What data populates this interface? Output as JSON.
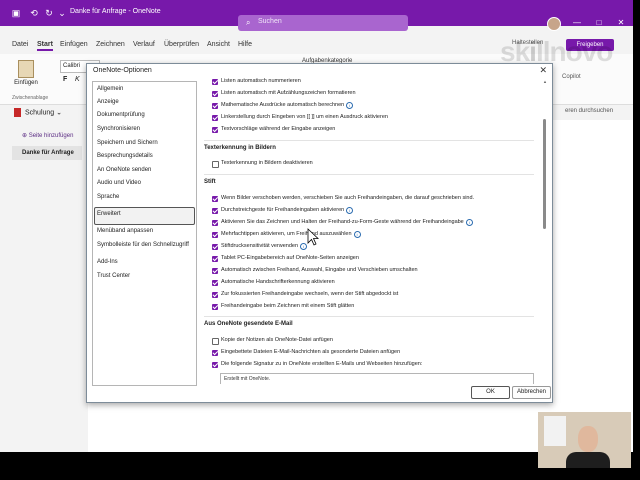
{
  "titlebar": {
    "doc_title": "Danke für Anfrage  -  OneNote",
    "search_placeholder": "Suchen",
    "bg_color": "#7719aa"
  },
  "menubar": {
    "tabs": [
      "Datei",
      "Start",
      "Einfügen",
      "Zeichnen",
      "Verlauf",
      "Überprüfen",
      "Ansicht",
      "Hilfe"
    ],
    "active_tab": "Start",
    "share_label": "Freigeben",
    "haltestellen": "Haltestellen"
  },
  "ribbon": {
    "paste_label": "Einfügen",
    "font_value": "Calibri",
    "bold": "F",
    "italic": "K",
    "clipboard_label": "Zwischenablage",
    "tag_label": "Aufgabenkategorie",
    "copilot_label": "Copilot",
    "search_right": "eren durchsuchen"
  },
  "nav": {
    "notebook": "Schulung",
    "add_page": "Seite hinzufügen",
    "page": "Danke für Anfrage"
  },
  "logo": "skillnovo",
  "dialog": {
    "title": "OneNote-Optionen",
    "nav_items": [
      "Allgemein",
      "Anzeige",
      "Dokumentprüfung",
      "Synchronisieren",
      "Speichern und Sichern",
      "Besprechungsdetails",
      "An OneNote senden",
      "Audio und Video",
      "Sprache",
      "Erweitert",
      "Menüband anpassen",
      "Symbolleiste für den Schnellzugriff",
      "Add-Ins",
      "Trust Center"
    ],
    "active_nav": "Erweitert",
    "top_options": [
      {
        "label": "Listen automatisch nummerieren",
        "checked": true
      },
      {
        "label": "Listen automatisch mit Aufzählungszeichen formatieren",
        "checked": true
      },
      {
        "label": "Mathematische Ausdrücke automatisch berechnen",
        "checked": true,
        "info": true
      },
      {
        "label": "Linkerstellung durch Eingeben von [[ ]] um einen Ausdruck aktivieren",
        "checked": true
      },
      {
        "label": "Textvorschläge während der Eingabe anzeigen",
        "checked": true
      }
    ],
    "section_ocr": {
      "heading": "Texterkennung in Bildern",
      "options": [
        {
          "label": "Texterkennung in Bildern deaktivieren",
          "checked": false
        }
      ]
    },
    "section_pen": {
      "heading": "Stift",
      "options": [
        {
          "label": "Wenn Bilder verschoben werden, verschieben Sie auch Freihandeingaben, die darauf geschrieben sind.",
          "checked": true
        },
        {
          "label": "Durchstreichgeste für Freihandeingaben aktivieren",
          "checked": true,
          "info": true
        },
        {
          "label": "Aktivieren Sie das Zeichnen und Halten der Freihand-zu-Form-Geste während der Freihandeingabe",
          "checked": true,
          "info": true
        },
        {
          "label": "Mehrfachtippen aktivieren, um Freihand auszuwählen",
          "checked": true,
          "info": true
        },
        {
          "label": "Stiftdrucksensitivität verwenden",
          "checked": true,
          "info": true
        },
        {
          "label": "Tablet PC-Eingabebereich auf OneNote-Seiten anzeigen",
          "checked": true
        },
        {
          "label": "Automatisch zwischen Freihand, Auswahl, Eingabe und Verschieben umschalten",
          "checked": true
        },
        {
          "label": "Automatische Handschrifterkennung aktivieren",
          "checked": true
        },
        {
          "label": "Zur fokussierten Freihandeingabe wechseln, wenn der Stift abgedockt ist",
          "checked": true
        },
        {
          "label": "Freihandeingabe beim Zeichnen mit einem Stift glätten",
          "checked": true
        }
      ]
    },
    "section_mail": {
      "heading": "Aus OneNote gesendete E-Mail",
      "options": [
        {
          "label": "Kopie der Notizen als OneNote-Datei anfügen",
          "checked": false
        },
        {
          "label": "Eingebettete Dateien E-Mail-Nachrichten als gesonderte Dateien anfügen",
          "checked": true
        },
        {
          "label": "Die folgende Signatur zu in OneNote erstellten E-Mails und Webseiten hinzufügen:",
          "checked": true
        }
      ],
      "signature": "Erstellt mit OneNote."
    },
    "ok_label": "OK",
    "cancel_label": "Abbrechen"
  }
}
